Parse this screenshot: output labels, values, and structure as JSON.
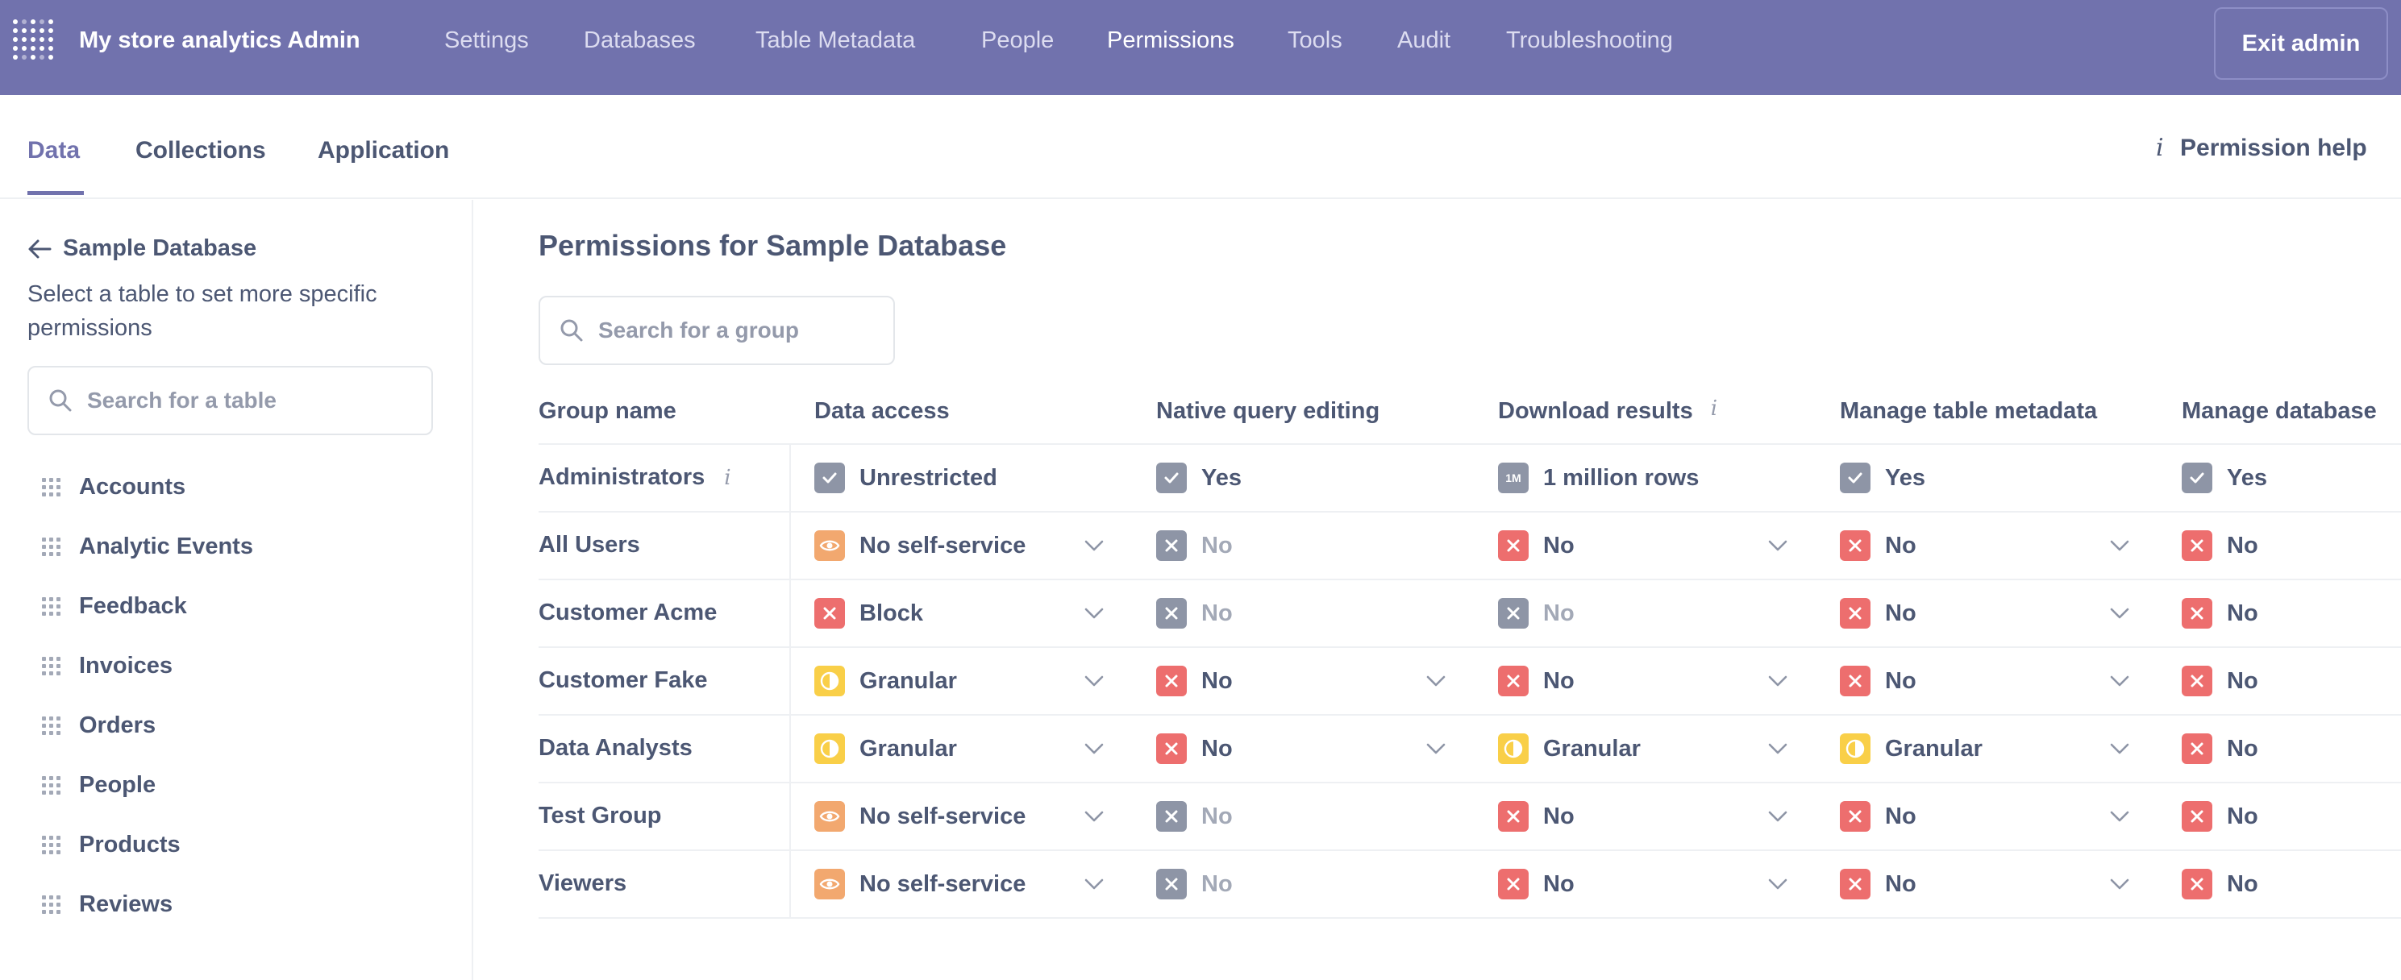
{
  "topnav": {
    "app_title": "My store analytics Admin",
    "items": [
      {
        "label": "Settings",
        "active": false
      },
      {
        "label": "Databases",
        "active": false
      },
      {
        "label": "Table Metadata",
        "active": false
      },
      {
        "label": "People",
        "active": false
      },
      {
        "label": "Permissions",
        "active": true
      },
      {
        "label": "Tools",
        "active": false
      },
      {
        "label": "Audit",
        "active": false
      },
      {
        "label": "Troubleshooting",
        "active": false
      }
    ],
    "exit_label": "Exit admin"
  },
  "tabs": [
    {
      "label": "Data",
      "active": true
    },
    {
      "label": "Collections",
      "active": false
    },
    {
      "label": "Application",
      "active": false
    }
  ],
  "permission_help": "Permission help",
  "sidebar": {
    "back_label": "Sample Database",
    "description": "Select a table to set more specific permissions",
    "search_placeholder": "Search for a table",
    "tables": [
      "Accounts",
      "Analytic Events",
      "Feedback",
      "Invoices",
      "Orders",
      "People",
      "Products",
      "Reviews"
    ]
  },
  "main": {
    "title": "Permissions for Sample Database",
    "search_placeholder": "Search for a group",
    "columns": [
      "Group name",
      "Data access",
      "Native query editing",
      "Download results",
      "Manage table metadata",
      "Manage database"
    ],
    "rows": [
      {
        "group": "Administrators",
        "info": true,
        "cells": [
          {
            "icon": "check",
            "label": "Unrestricted",
            "dropdown": false,
            "disabled": false
          },
          {
            "icon": "check",
            "label": "Yes",
            "dropdown": false,
            "disabled": false
          },
          {
            "icon": "1m",
            "badge_text": "1M",
            "label": "1 million rows",
            "dropdown": false,
            "disabled": false
          },
          {
            "icon": "check",
            "label": "Yes",
            "dropdown": false,
            "disabled": false
          },
          {
            "icon": "check",
            "label": "Yes",
            "dropdown": false,
            "disabled": false
          }
        ]
      },
      {
        "group": "All Users",
        "info": false,
        "cells": [
          {
            "icon": "eye",
            "label": "No self-service",
            "dropdown": true,
            "disabled": false
          },
          {
            "icon": "x",
            "label": "No",
            "dropdown": false,
            "disabled": true
          },
          {
            "icon": "x",
            "label": "No",
            "dropdown": true,
            "disabled": false
          },
          {
            "icon": "x",
            "label": "No",
            "dropdown": true,
            "disabled": false
          },
          {
            "icon": "x",
            "label": "No",
            "dropdown": false,
            "disabled": false
          }
        ]
      },
      {
        "group": "Customer Acme",
        "info": false,
        "cells": [
          {
            "icon": "x",
            "label": "Block",
            "dropdown": true,
            "disabled": false
          },
          {
            "icon": "x",
            "label": "No",
            "dropdown": false,
            "disabled": true
          },
          {
            "icon": "x",
            "label": "No",
            "dropdown": false,
            "disabled": true
          },
          {
            "icon": "x",
            "label": "No",
            "dropdown": true,
            "disabled": false
          },
          {
            "icon": "x",
            "label": "No",
            "dropdown": false,
            "disabled": false
          }
        ]
      },
      {
        "group": "Customer Fake",
        "info": false,
        "cells": [
          {
            "icon": "granular",
            "label": "Granular",
            "dropdown": true,
            "disabled": false
          },
          {
            "icon": "x",
            "label": "No",
            "dropdown": true,
            "disabled": false
          },
          {
            "icon": "x",
            "label": "No",
            "dropdown": true,
            "disabled": false
          },
          {
            "icon": "x",
            "label": "No",
            "dropdown": true,
            "disabled": false
          },
          {
            "icon": "x",
            "label": "No",
            "dropdown": false,
            "disabled": false
          }
        ]
      },
      {
        "group": "Data Analysts",
        "info": false,
        "cells": [
          {
            "icon": "granular",
            "label": "Granular",
            "dropdown": true,
            "disabled": false
          },
          {
            "icon": "x",
            "label": "No",
            "dropdown": true,
            "disabled": false
          },
          {
            "icon": "granular",
            "label": "Granular",
            "dropdown": true,
            "disabled": false
          },
          {
            "icon": "granular",
            "label": "Granular",
            "dropdown": true,
            "disabled": false
          },
          {
            "icon": "x",
            "label": "No",
            "dropdown": false,
            "disabled": false
          }
        ]
      },
      {
        "group": "Test Group",
        "info": false,
        "cells": [
          {
            "icon": "eye",
            "label": "No self-service",
            "dropdown": true,
            "disabled": false
          },
          {
            "icon": "x",
            "label": "No",
            "dropdown": false,
            "disabled": true
          },
          {
            "icon": "x",
            "label": "No",
            "dropdown": true,
            "disabled": false
          },
          {
            "icon": "x",
            "label": "No",
            "dropdown": true,
            "disabled": false
          },
          {
            "icon": "x",
            "label": "No",
            "dropdown": false,
            "disabled": false
          }
        ]
      },
      {
        "group": "Viewers",
        "info": false,
        "cells": [
          {
            "icon": "eye",
            "label": "No self-service",
            "dropdown": true,
            "disabled": false
          },
          {
            "icon": "x",
            "label": "No",
            "dropdown": false,
            "disabled": true
          },
          {
            "icon": "x",
            "label": "No",
            "dropdown": true,
            "disabled": false
          },
          {
            "icon": "x",
            "label": "No",
            "dropdown": true,
            "disabled": false
          },
          {
            "icon": "x",
            "label": "No",
            "dropdown": false,
            "disabled": false
          }
        ]
      }
    ]
  },
  "colors": {
    "brand": "#7172ad",
    "text": "#4c5773",
    "muted": "#a3a9b7",
    "danger": "#ed6e6e",
    "warning": "#f2a86f",
    "granular": "#f9cf48",
    "neutral": "#8e95a6"
  }
}
